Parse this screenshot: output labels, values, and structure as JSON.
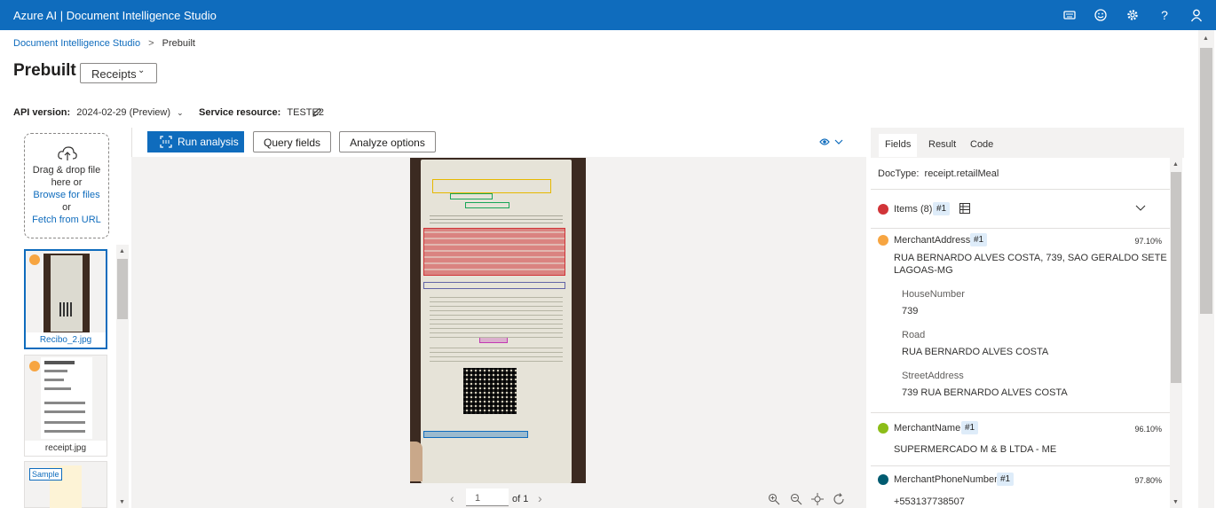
{
  "app": {
    "title": "Azure AI | Document Intelligence Studio"
  },
  "header_icons": [
    "keyboard-icon",
    "feedback-smile-icon",
    "settings-gear-icon",
    "help-icon",
    "user-account-icon"
  ],
  "breadcrumb": {
    "root": "Document Intelligence Studio",
    "current": "Prebuilt"
  },
  "page": {
    "title": "Prebuilt",
    "model_select": "Receipts"
  },
  "api": {
    "version_label": "API version:",
    "version_value": "2024-02-29 (Preview)",
    "resource_label": "Service resource:",
    "resource_value": "TESTE2"
  },
  "upload": {
    "drag_line1": "Drag & drop file",
    "drag_line2": "here or",
    "browse": "Browse for files",
    "or": "or",
    "fetch": "Fetch from URL"
  },
  "files": [
    {
      "name": "Recibo_2.jpg",
      "selected": true,
      "dot_color": "#f7a541"
    },
    {
      "name": "receipt.jpg",
      "selected": false,
      "dot_color": "#f7a541"
    },
    {
      "name": "",
      "selected": false,
      "sample_label": "Sample"
    }
  ],
  "toolbar": {
    "run": "Run analysis",
    "query": "Query fields",
    "options": "Analyze options"
  },
  "pager": {
    "current": "1",
    "of": "of 1"
  },
  "panel": {
    "tabs": [
      "Fields",
      "Result",
      "Code"
    ],
    "doctype_label": "DocType:",
    "doctype_value": "receipt.retailMeal",
    "items": {
      "label": "Items (8)",
      "badge": "#1",
      "color": "#d13438"
    },
    "fields": [
      {
        "name": "MerchantAddress",
        "badge": "#1",
        "confidence": "97.10%",
        "color": "#f7a541",
        "value_line1": "RUA BERNARDO ALVES COSTA, 739, SAO GERALDO SETE",
        "value_line2": "LAGOAS-MG",
        "sub": [
          {
            "label": "HouseNumber",
            "value": "739"
          },
          {
            "label": "Road",
            "value": "RUA BERNARDO ALVES COSTA"
          },
          {
            "label": "StreetAddress",
            "value": "739 RUA BERNARDO ALVES COSTA"
          }
        ]
      },
      {
        "name": "MerchantName",
        "badge": "#1",
        "confidence": "96.10%",
        "color": "#8cbd18",
        "value": "SUPERMERCADO M & B LTDA - ME"
      },
      {
        "name": "MerchantPhoneNumber",
        "badge": "#1",
        "confidence": "97.80%",
        "color": "#005b70",
        "value": "+553137738507"
      }
    ]
  }
}
